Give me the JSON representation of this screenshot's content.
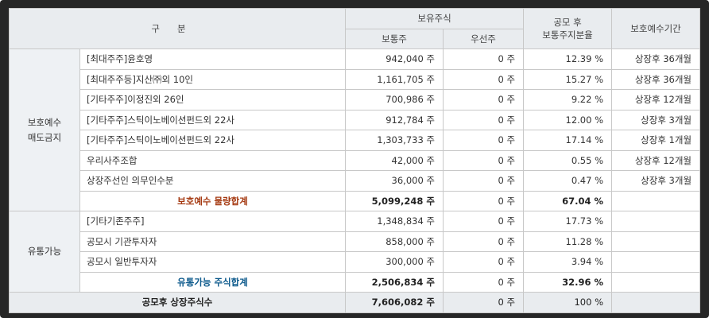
{
  "header": {
    "category": "구분",
    "holding": "보유주식",
    "common": "보통주",
    "preferred": "우선주",
    "ratio_line1": "공모 후",
    "ratio_line2": "보통주지분율",
    "lockup": "보호예수기간"
  },
  "groups": [
    {
      "label_line1": "보호예수",
      "label_line2": "매도금지",
      "rows": [
        {
          "name": "[최대주주]윤호영",
          "common": "942,040 주",
          "preferred": "0 주",
          "ratio": "12.39 %",
          "period": "상장후 36개월"
        },
        {
          "name": "[최대주주등]지산㈜외 10인",
          "common": "1,161,705 주",
          "preferred": "0 주",
          "ratio": "15.27 %",
          "period": "상장후 36개월"
        },
        {
          "name": "[기타주주]이정진외 26인",
          "common": "700,986 주",
          "preferred": "0 주",
          "ratio": "9.22 %",
          "period": "상장후 12개월"
        },
        {
          "name": "[기타주주]스틱이노베이션펀드외 22사",
          "common": "912,784 주",
          "preferred": "0 주",
          "ratio": "12.00 %",
          "period": "상장후 3개월"
        },
        {
          "name": "[기타주주]스틱이노베이션펀드외 22사",
          "common": "1,303,733 주",
          "preferred": "0 주",
          "ratio": "17.14 %",
          "period": "상장후 1개월"
        },
        {
          "name": "우리사주조합",
          "common": "42,000 주",
          "preferred": "0 주",
          "ratio": "0.55 %",
          "period": "상장후 12개월"
        },
        {
          "name": "상장주선인 의무인수분",
          "common": "36,000 주",
          "preferred": "0 주",
          "ratio": "0.47 %",
          "period": "상장후 3개월"
        }
      ],
      "subtotal": {
        "name": "보호예수 물량합계",
        "common": "5,099,248 주",
        "preferred": "0 주",
        "ratio": "67.04 %",
        "period": ""
      }
    },
    {
      "label_line1": "유통가능",
      "label_line2": "",
      "rows": [
        {
          "name": "[기타기존주주]",
          "common": "1,348,834 주",
          "preferred": "0 주",
          "ratio": "17.73 %",
          "period": ""
        },
        {
          "name": "공모시 기관투자자",
          "common": "858,000 주",
          "preferred": "0 주",
          "ratio": "11.28 %",
          "period": ""
        },
        {
          "name": "공모시 일반투자자",
          "common": "300,000 주",
          "preferred": "0 주",
          "ratio": "3.94 %",
          "period": ""
        }
      ],
      "subtotal": {
        "name": "유통가능 주식합계",
        "common": "2,506,834 주",
        "preferred": "0 주",
        "ratio": "32.96 %",
        "period": ""
      }
    }
  ],
  "total": {
    "name": "공모후 상장주식수",
    "common": "7,606,082 주",
    "preferred": "0 주",
    "ratio": "100 %",
    "period": ""
  }
}
